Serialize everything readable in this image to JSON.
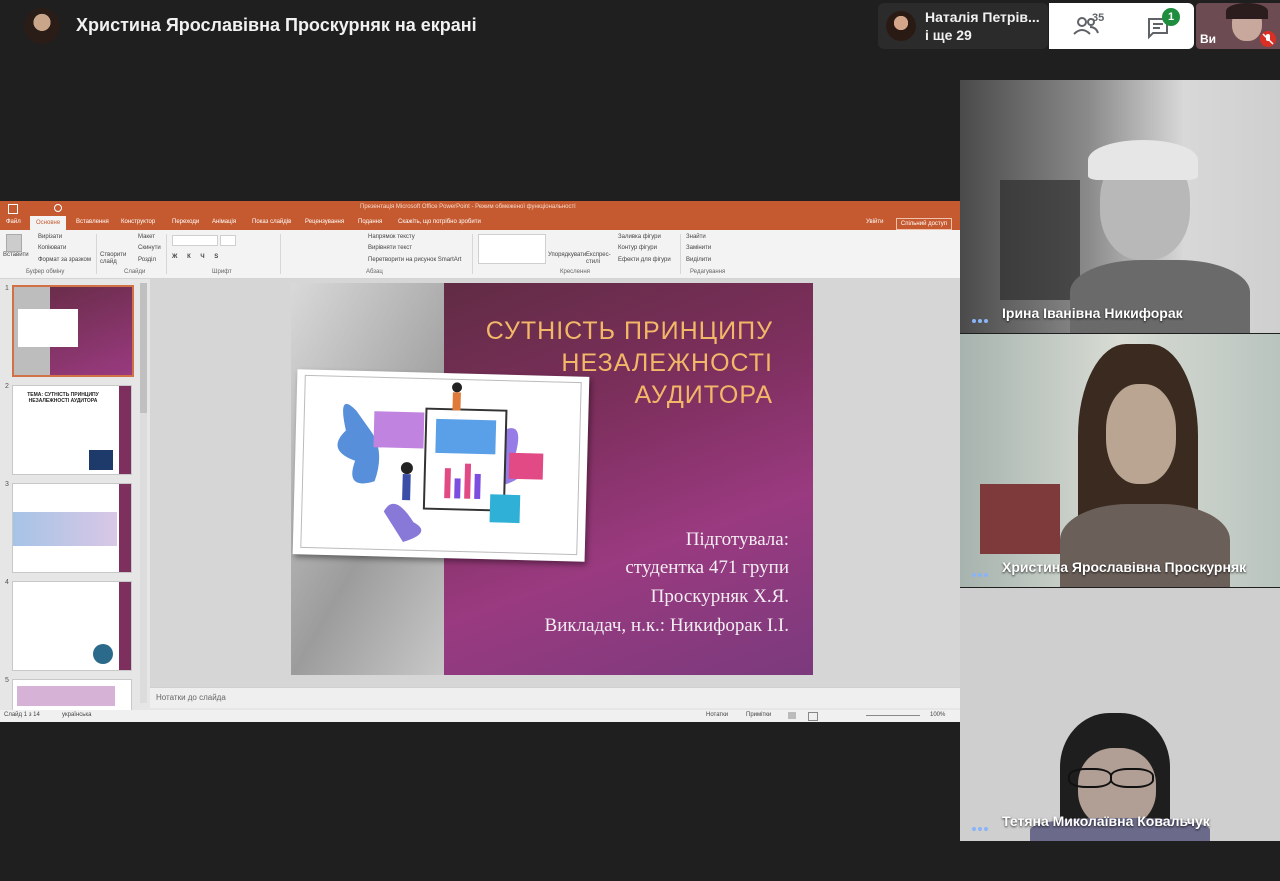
{
  "meet": {
    "presenter_banner": "Христина Ярославівна Проскурняк на екрані",
    "participants_chip": {
      "name": "Наталія Петрів...",
      "more": "і ще 29"
    },
    "people_count": "35",
    "chat_badge": "1",
    "self_label": "Ви",
    "icons": [
      "people-icon",
      "chat-icon",
      "mic-off-icon",
      "more-dots-icon"
    ],
    "accent_color": "#8ab4f8",
    "badge_color": "#1e8e3e"
  },
  "powerpoint": {
    "window_title": "Презентація Microsoft Office PowerPoint - Режим обмеженої функціональності",
    "tabs": [
      "Файл",
      "Основне",
      "Вставлення",
      "Конструктор",
      "Переходи",
      "Анімація",
      "Показ слайдів",
      "Рецензування",
      "Подання",
      "Скажіть, що потрібно зробити"
    ],
    "sign_in": "Увійти",
    "share": "Спільний доступ",
    "ribbon": {
      "paste": "Вставити",
      "cut": "Вирізати",
      "copy": "Копіювати",
      "format_painter": "Формат за зразком",
      "new_slide": "Створити слайд",
      "layout": "Макет",
      "reset": "Скинути",
      "section": "Розділ",
      "text_direction": "Напрямок тексту",
      "align_text": "Вирівняти текст",
      "smartart": "Перетворити на рисунок SmartArt",
      "arrange": "Упорядкувати",
      "quick_styles": "Експрес-стилі",
      "shape_fill": "Заливка фігури",
      "shape_outline": "Контур фігури",
      "shape_effects": "Ефекти для фігури",
      "find": "Знайти",
      "replace": "Замінити",
      "select": "Виділити",
      "groups": [
        "Буфер обміну",
        "Слайди",
        "Шрифт",
        "Абзац",
        "Креслення",
        "Редагування"
      ]
    },
    "thumbnails": [
      {
        "num": "1"
      },
      {
        "num": "2",
        "title": "ТЕМА: СУТНІСТЬ ПРИНЦИПУ НЕЗАЛЕЖНОСТІ АУДИТОРА"
      },
      {
        "num": "3"
      },
      {
        "num": "4"
      },
      {
        "num": "5"
      }
    ],
    "slide": {
      "title_lines": [
        "СУТНІСТЬ ПРИНЦИПУ",
        "НЕЗАЛЕЖНОСТІ",
        "АУДИТОРА"
      ],
      "prepared_by": "Підготувала:",
      "student_group": "студентка 471 групи",
      "student_name": "Проскурняк Х.Я.",
      "teacher": "Викладач, н.к.: Никифорак І.І."
    },
    "notes_placeholder": "Нотатки до слайда",
    "status": {
      "slide_counter": "Слайд 1 з 14",
      "language": "українська",
      "notes_btn": "Нотатки",
      "comments_btn": "Примітки",
      "zoom": "100%"
    }
  },
  "tiles": [
    {
      "name": "Ірина Іванівна Никифорак"
    },
    {
      "name": "Христина Ярославівна Проскурняк"
    },
    {
      "name": "Тетяна Миколаївна Ковальчук"
    }
  ]
}
